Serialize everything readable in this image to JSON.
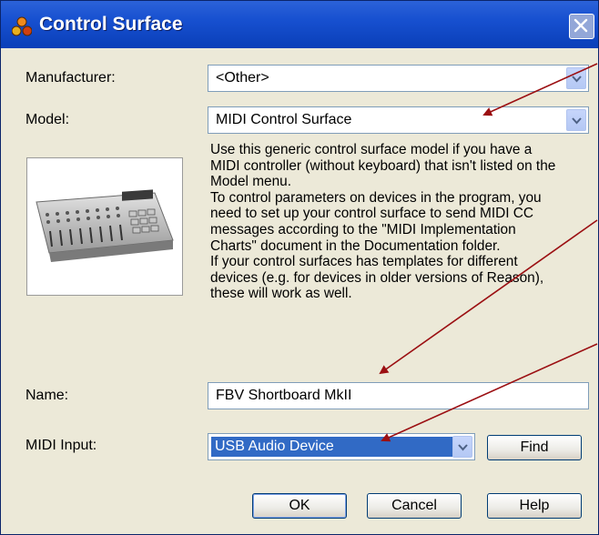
{
  "window": {
    "title": "Control Surface"
  },
  "form": {
    "manufacturer_label": "Manufacturer:",
    "manufacturer_value": "<Other>",
    "model_label": "Model:",
    "model_value": "MIDI Control Surface",
    "name_label": "Name:",
    "name_value": "FBV Shortboard MkII",
    "midi_input_label": "MIDI Input:",
    "midi_input_value": "USB Audio Device"
  },
  "description": [
    "Use this generic control surface model if you have a",
    "MIDI controller (without keyboard) that isn't listed on the",
    "Model menu.",
    "To control parameters on devices in the program, you",
    "need to set up your control surface to send MIDI CC",
    "messages according to the \"MIDI Implementation",
    "Charts\" document in the Documentation folder.",
    "If your control surfaces has templates for different",
    "devices (e.g. for devices in older versions of Reason),",
    "these will work as well."
  ],
  "buttons": {
    "find": "Find",
    "ok": "OK",
    "cancel": "Cancel",
    "help": "Help"
  },
  "colors": {
    "titlebar": "#0a3fb8",
    "annotation_arrow": "#9b0f12",
    "selection": "#316ac5"
  }
}
